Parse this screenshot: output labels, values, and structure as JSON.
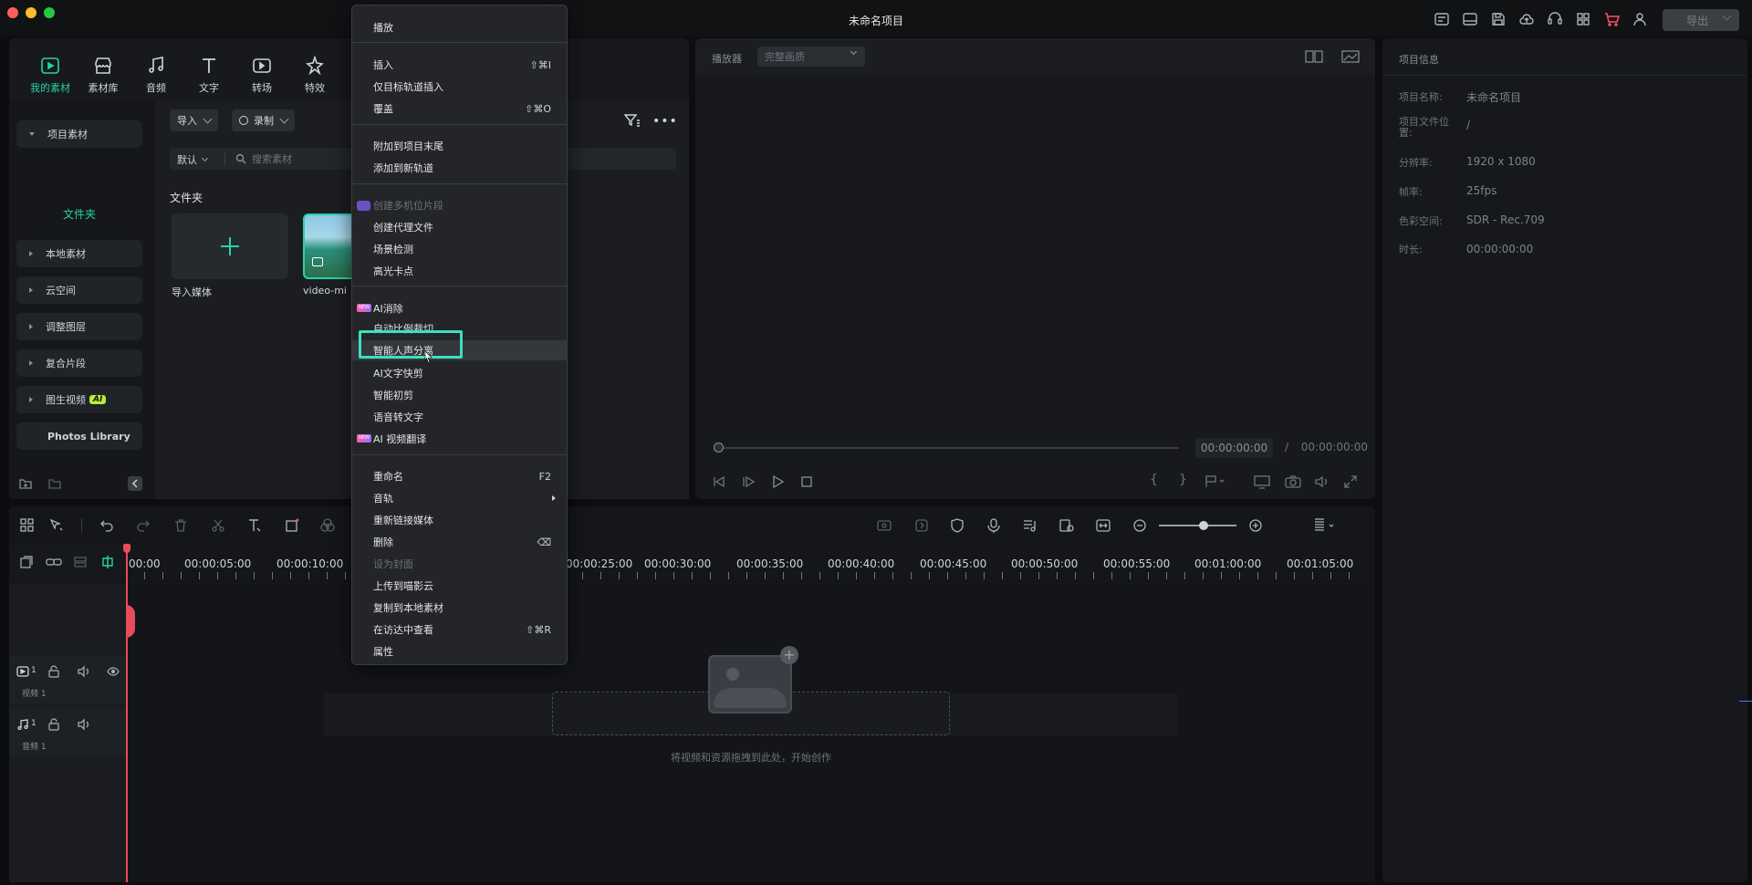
{
  "window": {
    "title": "未命名项目",
    "export_label": "导出"
  },
  "tabs": [
    {
      "label": "我的素材",
      "icon": "my-media-icon"
    },
    {
      "label": "素材库",
      "icon": "stock-icon"
    },
    {
      "label": "音频",
      "icon": "music-icon"
    },
    {
      "label": "文字",
      "icon": "text-icon"
    },
    {
      "label": "转场",
      "icon": "transition-icon"
    },
    {
      "label": "特效",
      "icon": "effects-icon"
    }
  ],
  "sidebar": {
    "project_media": "项目素材",
    "folder": "文件夹",
    "items": [
      "本地素材",
      "云空间",
      "调整图层",
      "复合片段",
      "图生视频"
    ],
    "ai_badge": "AI",
    "photos_library": "Photos Library"
  },
  "media": {
    "import_label": "导入",
    "record_label": "录制",
    "sort_label": "默认",
    "search_placeholder": "搜索素材",
    "section_title": "文件夹",
    "import_media_label": "导入媒体",
    "clip_name": "video-mi"
  },
  "context_menu": {
    "groups": [
      [
        {
          "label": "播放"
        }
      ],
      [
        {
          "label": "插入",
          "shortcut": "⇧⌘I"
        },
        {
          "label": "仅目标轨道插入"
        },
        {
          "label": "覆盖",
          "shortcut": "⇧⌘O"
        }
      ],
      [
        {
          "label": "附加到项目末尾"
        },
        {
          "label": "添加到新轨道"
        }
      ],
      [
        {
          "label": "创建多机位片段",
          "disabled": true,
          "badge": "multicam"
        },
        {
          "label": "创建代理文件"
        },
        {
          "label": "场景检测"
        },
        {
          "label": "高光卡点"
        }
      ],
      [
        {
          "label": "AI消除",
          "badge": "new"
        },
        {
          "label": "自动比例裁切"
        },
        {
          "label": "智能人声分离",
          "highlighted": true
        },
        {
          "label": "AI文字快剪"
        },
        {
          "label": "智能初剪"
        },
        {
          "label": "语音转文字"
        },
        {
          "label": "AI 视频翻译",
          "badge": "new"
        }
      ],
      [
        {
          "label": "重命名",
          "shortcut": "F2"
        },
        {
          "label": "音轨",
          "submenu": true
        },
        {
          "label": "重新链接媒体"
        },
        {
          "label": "删除",
          "shortcut": "⌫"
        },
        {
          "label": "设为封面",
          "disabled": true
        },
        {
          "label": "上传到喵影云"
        },
        {
          "label": "复制到本地素材"
        },
        {
          "label": "在访达中查看",
          "shortcut": "⇧⌘R"
        },
        {
          "label": "属性"
        }
      ]
    ],
    "new_badge": "NEW"
  },
  "player": {
    "label": "播放器",
    "quality": "完整画质",
    "current_time": "00:00:00:00",
    "separator": "/",
    "total_time": "00:00:00:00",
    "progress": 0
  },
  "project_info": {
    "title": "项目信息",
    "rows": [
      {
        "key": "项目名称:",
        "value": "未命名项目"
      },
      {
        "key": "项目文件位置:",
        "value": "/"
      },
      {
        "key": "分辨率:",
        "value": "1920 x 1080"
      },
      {
        "key": "帧率:",
        "value": "25fps"
      },
      {
        "key": "色彩空间:",
        "value": "SDR - Rec.709"
      },
      {
        "key": "时长:",
        "value": "00:00:00:00"
      }
    ]
  },
  "timeline": {
    "ruler": [
      "00:00",
      "00:00:05:00",
      "00:00:10:00",
      "00:00:25:00",
      "00:00:30:00",
      "00:00:35:00",
      "00:00:40:00",
      "00:00:45:00",
      "00:00:50:00",
      "00:00:55:00",
      "00:01:00:00",
      "00:01:05:00"
    ],
    "video_track": "视频 1",
    "audio_track": "音频 1",
    "track_number": "1",
    "drop_hint": "将视频和资源拖拽到此处，开始创作"
  }
}
